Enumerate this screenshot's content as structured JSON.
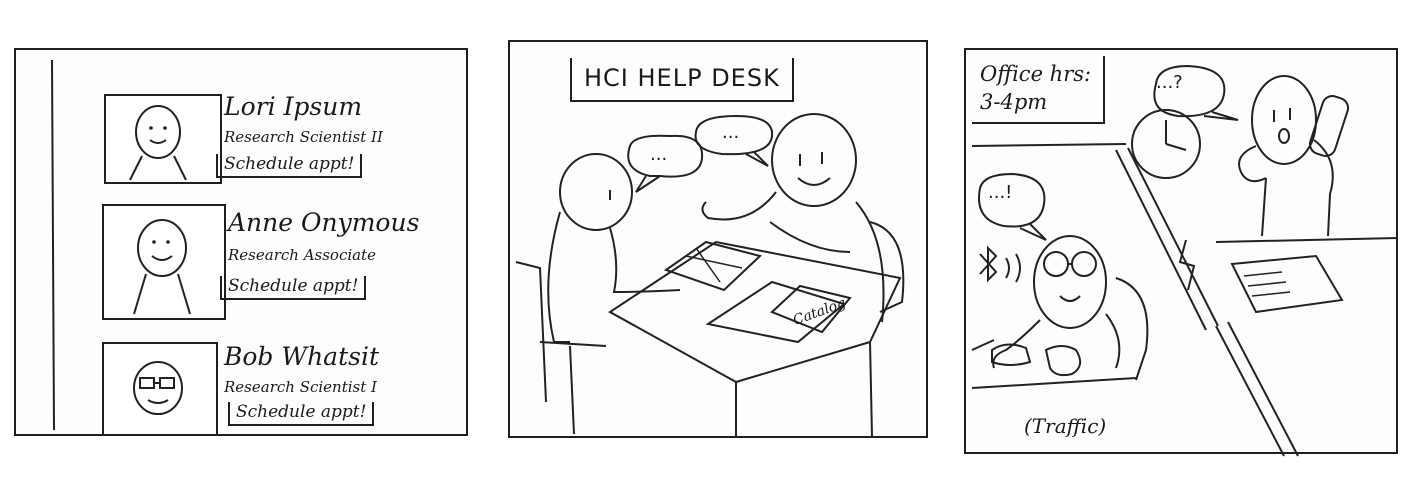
{
  "panel1": {
    "staff": [
      {
        "name": "Lori Ipsum",
        "role": "Research Scientist II",
        "action": "Schedule appt!"
      },
      {
        "name": "Anne Onymous",
        "role": "Research Associate",
        "action": "Schedule appt!"
      },
      {
        "name": "Bob Whatsit",
        "role": "Research Scientist I",
        "action": "Schedule appt!"
      }
    ]
  },
  "panel2": {
    "sign": "HCI HELP DESK",
    "bubble_left": "...",
    "bubble_right": "...",
    "catalog_label": "Catalog"
  },
  "panel3": {
    "hours_line1": "Office hrs:",
    "hours_line2": "3-4pm",
    "bubble_phone": "...?",
    "bubble_desk": "...!",
    "caption": "(Traffic)"
  }
}
